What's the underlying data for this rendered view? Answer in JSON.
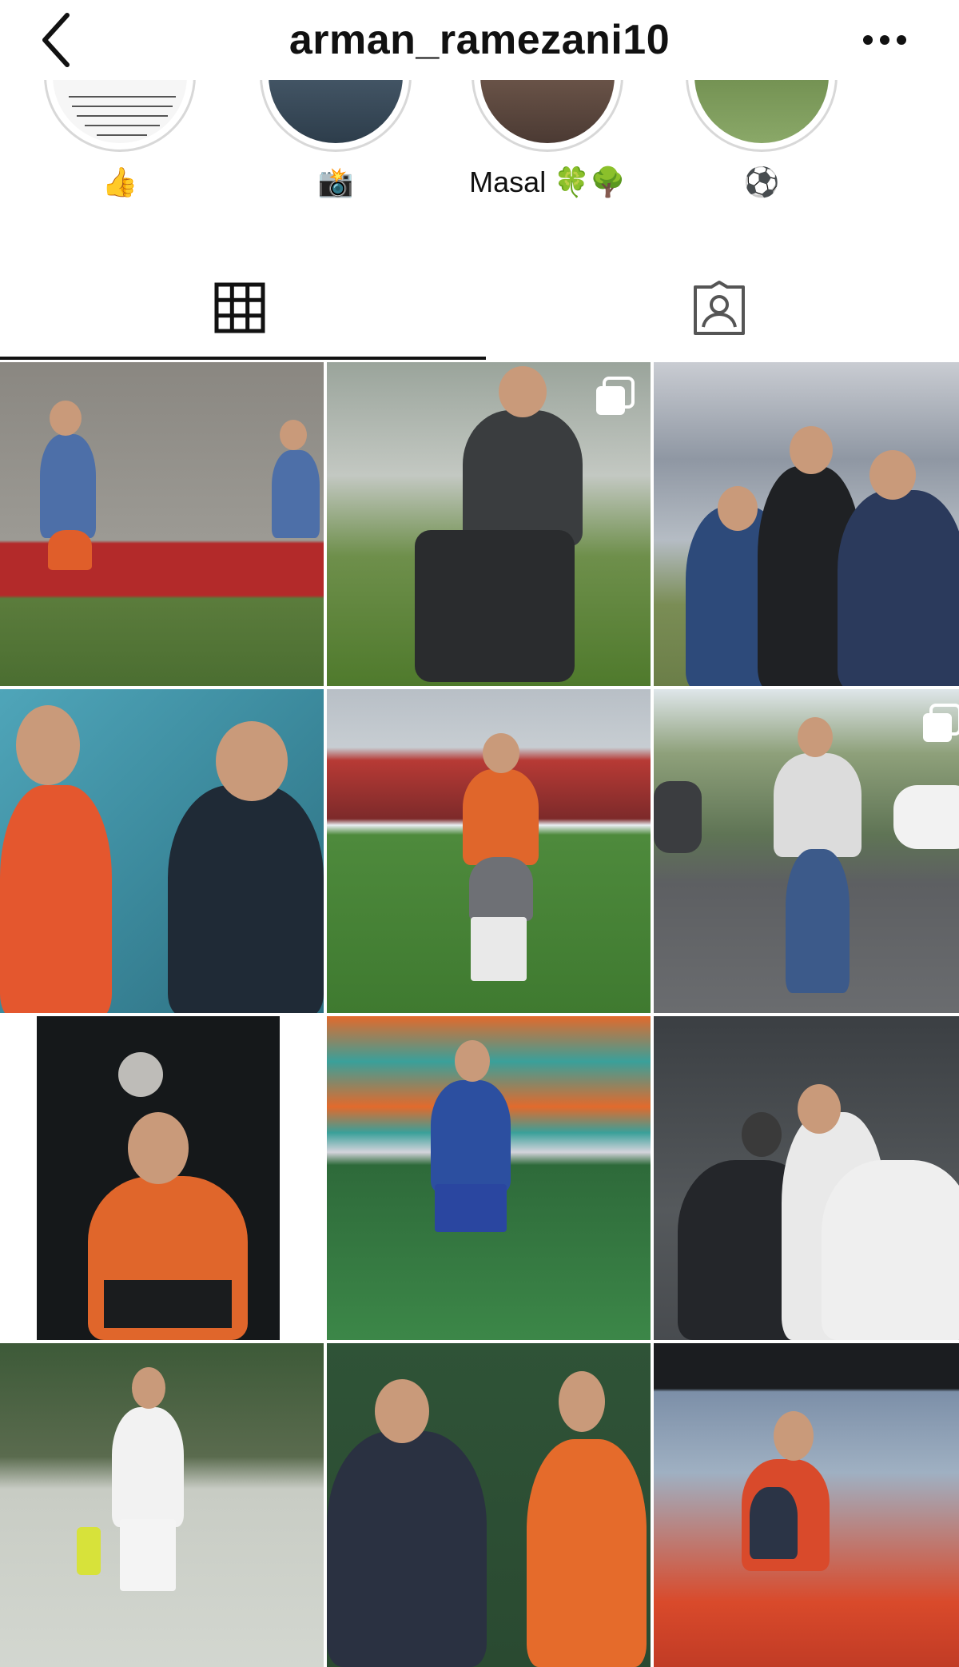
{
  "header": {
    "username": "arman_ramezani10",
    "back_icon": "chevron-left-icon",
    "more_icon": "more-horizontal-icon"
  },
  "highlights": [
    {
      "label": "👍",
      "thumb_color": "#f4f4f4"
    },
    {
      "label": "📸",
      "thumb_color": "#3d566b"
    },
    {
      "label": "Masal 🍀🌳",
      "thumb_color": "#6b5447"
    },
    {
      "label": "⚽",
      "thumb_color": "#6c8a4a"
    }
  ],
  "tabs": [
    {
      "name": "posts-grid",
      "icon": "grid-icon",
      "active": true
    },
    {
      "name": "tagged",
      "icon": "tagged-user-icon",
      "active": false
    }
  ],
  "posts": [
    {
      "id": 1,
      "multiple": false,
      "palette": [
        "#8f8d86",
        "#b32a2a",
        "#5b7c3c"
      ]
    },
    {
      "id": 2,
      "multiple": true,
      "palette": [
        "#9aa49b",
        "#3a3d3f",
        "#5f8a35"
      ]
    },
    {
      "id": 3,
      "multiple": false,
      "palette": [
        "#c9ccd2",
        "#2d4a7a",
        "#7a8d55"
      ]
    },
    {
      "id": 4,
      "multiple": false,
      "palette": [
        "#3c8a9d",
        "#e4572e",
        "#1f2a36"
      ]
    },
    {
      "id": 5,
      "multiple": false,
      "palette": [
        "#b8bfc6",
        "#b73a35",
        "#4e8a3c"
      ]
    },
    {
      "id": 6,
      "multiple": true,
      "palette": [
        "#7b8e6d",
        "#5d5f62",
        "#dcdcdc"
      ]
    },
    {
      "id": 7,
      "multiple": false,
      "palette": [
        "#ffffff",
        "#15181a",
        "#e0662b"
      ]
    },
    {
      "id": 8,
      "multiple": false,
      "palette": [
        "#3aa09a",
        "#e26a2c",
        "#2e6a3a"
      ]
    },
    {
      "id": 9,
      "multiple": false,
      "palette": [
        "#55595c",
        "#e9e9e9",
        "#24262a"
      ]
    },
    {
      "id": 10,
      "multiple": false,
      "palette": [
        "#3d5a38",
        "#f2f2f2",
        "#d3d7d0"
      ]
    },
    {
      "id": 11,
      "multiple": false,
      "palette": [
        "#2f5337",
        "#2a3141",
        "#e56b2b"
      ]
    },
    {
      "id": 12,
      "multiple": false,
      "palette": [
        "#7c8fa8",
        "#d94a2b",
        "#2b3446"
      ]
    }
  ]
}
